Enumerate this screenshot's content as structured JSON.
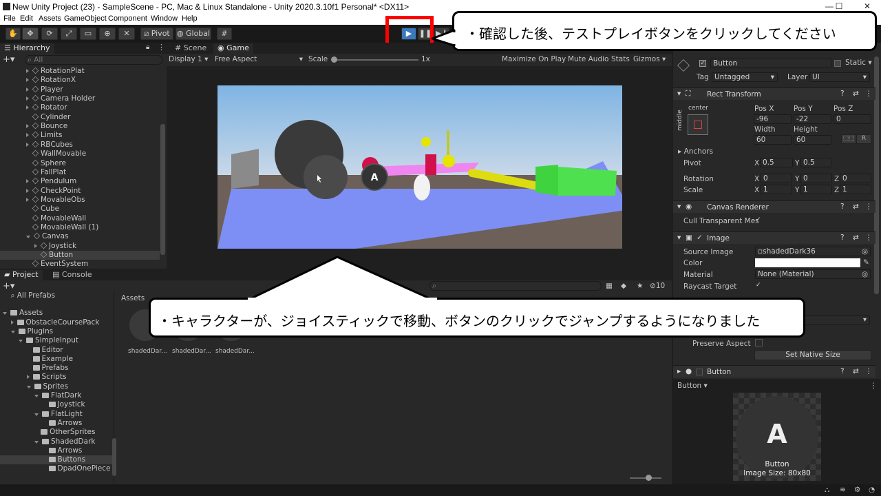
{
  "window": {
    "title": "New Unity Project (23) - SampleScene - PC, Mac & Linux Standalone - Unity 2020.3.10f1 Personal* <DX11>",
    "minimize": "—",
    "maximize": "☐",
    "close": "✕"
  },
  "menu": [
    "File",
    "Edit",
    "Assets",
    "GameObject",
    "Component",
    "Window",
    "Help"
  ],
  "toolbar": {
    "pivot": "Pivot",
    "global": "Global"
  },
  "hierarchy": {
    "tab": "Hierarchy",
    "search_placeholder": "All",
    "items": [
      {
        "label": "RotationPlat",
        "depth": 1,
        "expand": "closed"
      },
      {
        "label": "RotationX",
        "depth": 1,
        "expand": "closed"
      },
      {
        "label": "Player",
        "depth": 1,
        "expand": "closed"
      },
      {
        "label": "Camera Holder",
        "depth": 1,
        "expand": "closed"
      },
      {
        "label": "Rotator",
        "depth": 1,
        "expand": "closed"
      },
      {
        "label": "Cylinder",
        "depth": 1,
        "expand": "none"
      },
      {
        "label": "Bounce",
        "depth": 1,
        "expand": "closed"
      },
      {
        "label": "Limits",
        "depth": 1,
        "expand": "closed"
      },
      {
        "label": "RBCubes",
        "depth": 1,
        "expand": "closed"
      },
      {
        "label": "WallMovable",
        "depth": 1,
        "expand": "none"
      },
      {
        "label": "Sphere",
        "depth": 1,
        "expand": "none"
      },
      {
        "label": "FallPlat",
        "depth": 1,
        "expand": "none"
      },
      {
        "label": "Pendulum",
        "depth": 1,
        "expand": "closed"
      },
      {
        "label": "CheckPoint",
        "depth": 1,
        "expand": "closed"
      },
      {
        "label": "MovableObs",
        "depth": 1,
        "expand": "closed"
      },
      {
        "label": "Cube",
        "depth": 1,
        "expand": "none"
      },
      {
        "label": "MovableWall",
        "depth": 1,
        "expand": "none"
      },
      {
        "label": "MovableWall (1)",
        "depth": 1,
        "expand": "none"
      },
      {
        "label": "Canvas",
        "depth": 1,
        "expand": "open"
      },
      {
        "label": "Joystick",
        "depth": 2,
        "expand": "closed"
      },
      {
        "label": "Button",
        "depth": 2,
        "expand": "none",
        "selected": true
      },
      {
        "label": "EventSystem",
        "depth": 1,
        "expand": "none"
      }
    ]
  },
  "scene_tabs": [
    "Scene",
    "Game"
  ],
  "game_toolbar": {
    "display": "Display 1",
    "aspect": "Free Aspect",
    "scale_label": "Scale",
    "scale_value": "1x",
    "maximize": "Maximize On Play",
    "mute": "Mute Audio",
    "stats": "Stats",
    "gizmos": "Gizmos"
  },
  "game_view": {
    "button_letter": "A"
  },
  "project": {
    "tabs": [
      "Project",
      "Console"
    ],
    "badge_count": "10",
    "breadcrumb": "Assets",
    "tree": [
      {
        "label": "All Prefabs",
        "depth": 1,
        "kind": "search"
      },
      {
        "label": "Assets",
        "depth": 0,
        "kind": "open"
      },
      {
        "label": "ObstacleCoursePack",
        "depth": 1,
        "kind": "closed"
      },
      {
        "label": "Plugins",
        "depth": 1,
        "kind": "open"
      },
      {
        "label": "SimpleInput",
        "depth": 2,
        "kind": "open"
      },
      {
        "label": "Editor",
        "depth": 3,
        "kind": "none"
      },
      {
        "label": "Example",
        "depth": 3,
        "kind": "none"
      },
      {
        "label": "Prefabs",
        "depth": 3,
        "kind": "none"
      },
      {
        "label": "Scripts",
        "depth": 3,
        "kind": "closed"
      },
      {
        "label": "Sprites",
        "depth": 3,
        "kind": "open"
      },
      {
        "label": "FlatDark",
        "depth": 4,
        "kind": "open"
      },
      {
        "label": "Joystick",
        "depth": 5,
        "kind": "none"
      },
      {
        "label": "FlatLight",
        "depth": 4,
        "kind": "open"
      },
      {
        "label": "Arrows",
        "depth": 5,
        "kind": "none"
      },
      {
        "label": "OtherSprites",
        "depth": 4,
        "kind": "none"
      },
      {
        "label": "ShadedDark",
        "depth": 4,
        "kind": "open"
      },
      {
        "label": "Arrows",
        "depth": 5,
        "kind": "none"
      },
      {
        "label": "Buttons",
        "depth": 5,
        "kind": "none",
        "selected": true
      },
      {
        "label": "DpadOnePiece",
        "depth": 5,
        "kind": "none"
      }
    ],
    "assets": [
      "shadedDar...",
      "shadedDar...",
      "shadedDar..."
    ]
  },
  "inspector": {
    "object_name": "Button",
    "static_label": "Static",
    "tag_label": "Tag",
    "tag_value": "Untagged",
    "layer_label": "Layer",
    "layer_value": "UI",
    "rect_transform": {
      "title": "Rect Transform",
      "anchor_h": "center",
      "anchor_v": "middle",
      "pos_x_label": "Pos X",
      "pos_x": "-96",
      "pos_y_label": "Pos Y",
      "pos_y": "-22",
      "pos_z_label": "Pos Z",
      "pos_z": "0",
      "width_label": "Width",
      "width": "60",
      "height_label": "Height",
      "height": "60",
      "anchors": "Anchors",
      "pivot_label": "Pivot",
      "pivot_x": "0.5",
      "pivot_y": "0.5",
      "rotation_label": "Rotation",
      "rot_x": "0",
      "rot_y": "0",
      "rot_z": "0",
      "scale_label": "Scale",
      "scale_x": "1",
      "scale_y": "1",
      "scale_z": "1",
      "x": "X",
      "y": "Y",
      "z": "Z"
    },
    "canvas_renderer": {
      "title": "Canvas Renderer",
      "cull": "Cull Transparent Mes"
    },
    "image": {
      "title": "Image",
      "source_label": "Source Image",
      "source_value": "shadedDark36",
      "color_label": "Color",
      "material_label": "Material",
      "material_value": "None (Material)",
      "raycast_label": "Raycast Target",
      "preserve_label": "Preserve Aspect",
      "native_button": "Set Native Size"
    },
    "button_component": {
      "title": "Button"
    },
    "preview": {
      "dropdown": "Button",
      "letter": "A",
      "name": "Button",
      "size": "Image Size: 80x80"
    }
  },
  "callouts": {
    "top": "・確認した後、テストプレイボタンをクリックしてください",
    "bottom": "・キャラクターが、ジョイスティックで移動、ボタンのクリックでジャンプするようになりました"
  },
  "colors": {
    "highlight": "#ff0000",
    "play_active": "#3a79bb"
  }
}
